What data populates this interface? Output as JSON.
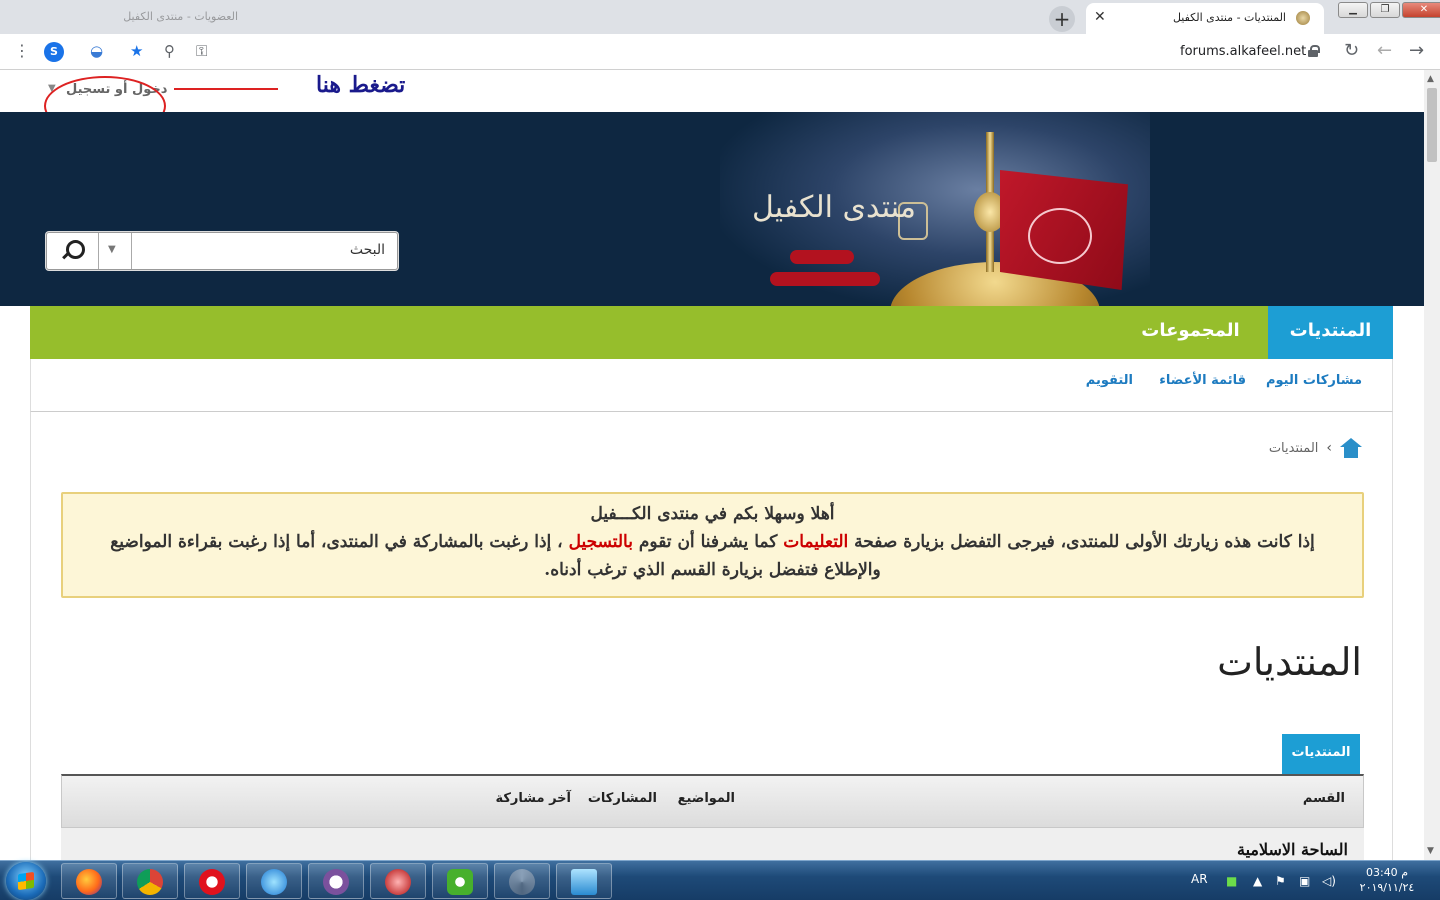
{
  "browser": {
    "tab_title": "المنتديات - منتدى الكفيل",
    "inactive_tab_title": "العضويات - منتدى الكفيل",
    "url": "forums.alkafeel.net",
    "profile_initial": "S",
    "window_minimize": "▁",
    "window_maximize": "❐",
    "window_close": "✕",
    "new_tab": "+",
    "tab_close": "✕"
  },
  "annotation": {
    "login_link": "دخول أو تسجيل",
    "press_here": "تضغط هنا"
  },
  "search": {
    "placeholder": "البحث"
  },
  "main_nav": {
    "forums": "المنتديات",
    "groups": "المجموعات"
  },
  "sub_nav": {
    "todays_posts": "مشاركات اليوم",
    "members_list": "قائمة الأعضاء",
    "calendar": "التقويم"
  },
  "breadcrumb": {
    "current": "المنتديات"
  },
  "notice": {
    "greeting": "أهلا وسهلا بكم في منتدى الكـــفيل",
    "body_part1": "إذا كانت هذه زيارتك الأولى للمنتدى، فيرجى التفضل بزيارة صفحة ",
    "instructions_link": "التعليمات",
    "body_part2": " كما يشرفنا أن تقوم ",
    "register_link": "بالتسجيل",
    "body_part3": " ، إذا رغبت بالمشاركة في المنتدى، أما إذا رغبت بقراءة المواضيع والإطلاع فتفضل بزيارة القسم الذي ترغب أدناه."
  },
  "page_heading": "المنتديات",
  "forums_tab_label": "المنتديات",
  "table": {
    "col_section": "القسم",
    "col_topics": "المواضيع",
    "col_posts": "المشاركات",
    "col_last_post": "آخر مشاركة",
    "first_section": "الساحة الاسلامية"
  },
  "taskbar": {
    "language": "AR",
    "time": "03:40 م",
    "date": "٢٠١٩/١١/٢٤"
  },
  "colors": {
    "nav_green": "#96be2c",
    "nav_blue": "#1d9ed4",
    "banner_navy": "#0e2741",
    "notice_bg": "#fdf6d7",
    "link_red": "#cc0000"
  }
}
